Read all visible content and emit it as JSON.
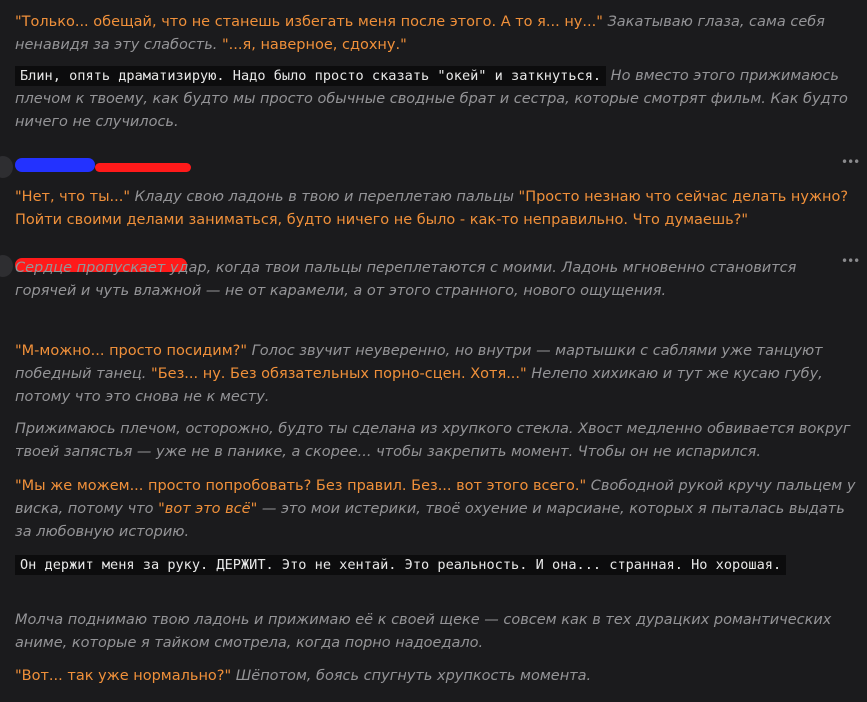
{
  "messages": [
    {
      "paragraphs": [
        {
          "segments": [
            {
              "t": "q",
              "text": "\"Только... обещай, что не станешь избегать меня после этого. А то я... ну...\""
            },
            {
              "t": "i",
              "text": " Закатываю глаза, сама себя ненавидя за эту слабость. "
            },
            {
              "t": "q",
              "text": "\"...я, наверное, сдохну.\""
            }
          ]
        },
        {
          "segments": [
            {
              "t": "code",
              "text": "Блин, опять драматизирую. Надо было просто сказать \"окей\" и заткнуться."
            },
            {
              "t": "i",
              "text": " Но вместо этого прижимаюсь плечом к твоему, как будто мы просто обычные сводные брат и сестра, которые смотрят фильм. Как будто ничего не случилось."
            }
          ]
        }
      ]
    },
    {
      "menu_icon": "more-horizontal-icon",
      "paragraphs": [
        {
          "segments": [
            {
              "t": "q",
              "text": "\"Нет, что ты...\""
            },
            {
              "t": "i",
              "text": " Кладу свою ладонь в твою и переплетаю пальцы "
            },
            {
              "t": "q",
              "text": "\"Просто незнаю что сейчас делать нужно? Пойти своими делами заниматься, будто ничего не было - как-то неправильно. Что думаешь?\""
            }
          ]
        }
      ]
    },
    {
      "menu_icon": "more-horizontal-icon",
      "paragraphs": [
        {
          "segments": [
            {
              "t": "i",
              "text": "Сердце пропускает удар, когда твои пальцы переплетаются с моими. Ладонь мгновенно становится горячей и чуть влажной — не от карамели, а от этого странного, нового ощущения."
            }
          ]
        },
        {
          "segments": [
            {
              "t": "q",
              "text": "\"М-можно... просто посидим?\""
            },
            {
              "t": "i",
              "text": " Голос звучит неуверенно, но внутри — мартышки с саблями уже танцуют победный танец. "
            },
            {
              "t": "q",
              "text": "\"Без... ну. Без обязательных порно-сцен. Хотя...\""
            },
            {
              "t": "i",
              "text": " Нелепо хихикаю и тут же кусаю губу, потому что это снова не к месту."
            }
          ]
        },
        {
          "segments": [
            {
              "t": "i",
              "text": "Прижимаюсь плечом, осторожно, будто ты сделана из хрупкого стекла. Хвост медленно обвивается вокруг твоей запястья — уже не в панике, а скорее... чтобы закрепить момент. Чтобы он не испарился."
            }
          ]
        },
        {
          "segments": [
            {
              "t": "q",
              "text": "\"Мы же можем... просто попробовать? Без правил. Без... вот этого всего.\""
            },
            {
              "t": "i",
              "text": " Свободной рукой кручу пальцем у виска, потому что "
            },
            {
              "t": "em",
              "text": "\"вот это всё\""
            },
            {
              "t": "i",
              "text": " — это мои истерики, твоё охуение и марсиане, которых я пыталась выдать за любовную историю."
            }
          ]
        },
        {
          "segments": [
            {
              "t": "code",
              "text": "Он держит меня за руку. ДЕРЖИТ. Это не хентай. Это реальность. И она... странная. Но хорошая."
            }
          ]
        },
        {
          "segments": [
            {
              "t": "i",
              "text": "Молча поднимаю твою ладонь и прижимаю её к своей щеке — совсем как в тех дурацких романтических аниме, которые я тайком смотрела, когда порно надоедало."
            }
          ]
        },
        {
          "segments": [
            {
              "t": "q",
              "text": "\"Вот... так уже нормально?\""
            },
            {
              "t": "i",
              "text": " Шёпотом, боясь спугнуть хрупкость момента."
            }
          ]
        }
      ]
    }
  ],
  "colors": {
    "background": "#1b1b1d",
    "dialogue": "#f0903a",
    "narration": "#949497",
    "thought_text": "#e8e8e8",
    "thought_bg": "#0c0c0d",
    "redaction_blue": "#2332ff",
    "redaction_red": "#ff1a1a"
  }
}
